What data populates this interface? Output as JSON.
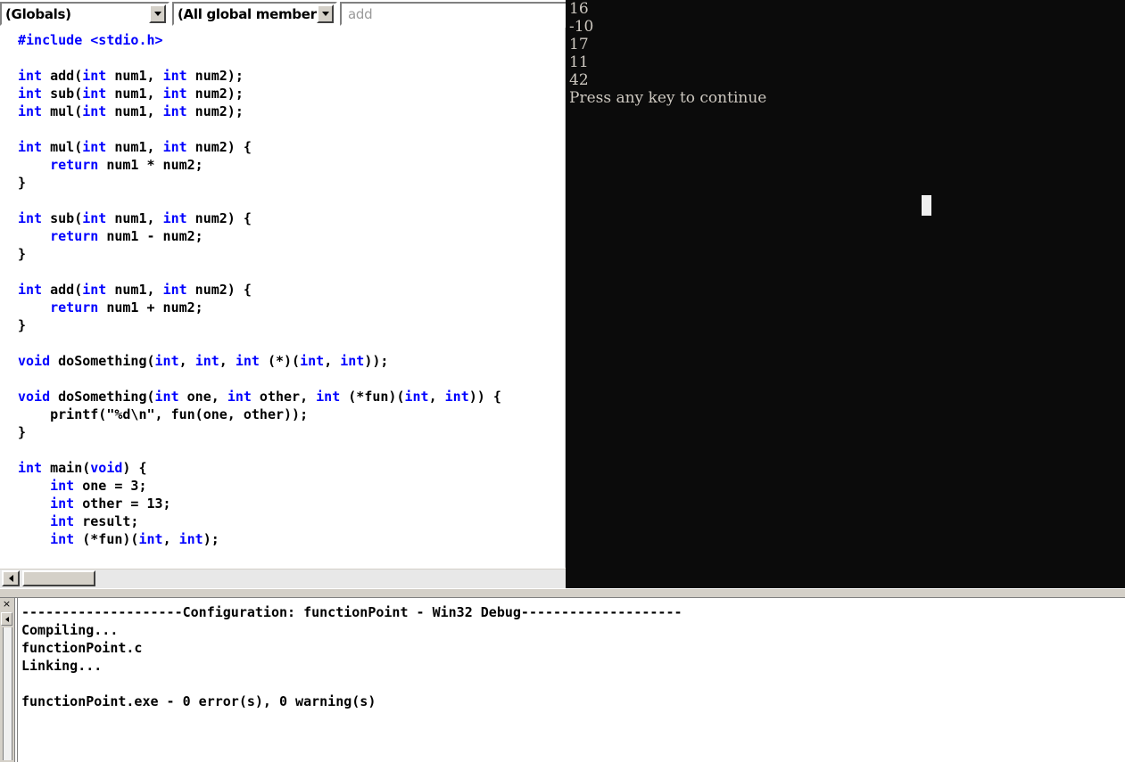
{
  "toolbar": {
    "scope_combo": {
      "value": "(Globals)",
      "dropdown_icon": "chevron-down-icon"
    },
    "members_combo": {
      "value": "(All global members",
      "dropdown_icon": "chevron-down-icon"
    },
    "find_field": {
      "value": "add",
      "placeholder": "add"
    }
  },
  "editor": {
    "language": "c",
    "keyword_color": "#0000ff",
    "text_color": "#000000",
    "background": "#ffffff",
    "lines": [
      [
        {
          "t": "#include <stdio.h>",
          "c": "kw"
        }
      ],
      [],
      [
        {
          "t": "int",
          "c": "kw"
        },
        {
          "t": " add("
        },
        {
          "t": "int",
          "c": "kw"
        },
        {
          "t": " num1, "
        },
        {
          "t": "int",
          "c": "kw"
        },
        {
          "t": " num2);"
        }
      ],
      [
        {
          "t": "int",
          "c": "kw"
        },
        {
          "t": " sub("
        },
        {
          "t": "int",
          "c": "kw"
        },
        {
          "t": " num1, "
        },
        {
          "t": "int",
          "c": "kw"
        },
        {
          "t": " num2);"
        }
      ],
      [
        {
          "t": "int",
          "c": "kw"
        },
        {
          "t": " mul("
        },
        {
          "t": "int",
          "c": "kw"
        },
        {
          "t": " num1, "
        },
        {
          "t": "int",
          "c": "kw"
        },
        {
          "t": " num2);"
        }
      ],
      [],
      [
        {
          "t": "int",
          "c": "kw"
        },
        {
          "t": " mul("
        },
        {
          "t": "int",
          "c": "kw"
        },
        {
          "t": " num1, "
        },
        {
          "t": "int",
          "c": "kw"
        },
        {
          "t": " num2) {"
        }
      ],
      [
        {
          "t": "    "
        },
        {
          "t": "return",
          "c": "kw"
        },
        {
          "t": " num1 * num2;"
        }
      ],
      [
        {
          "t": "}"
        }
      ],
      [],
      [
        {
          "t": "int",
          "c": "kw"
        },
        {
          "t": " sub("
        },
        {
          "t": "int",
          "c": "kw"
        },
        {
          "t": " num1, "
        },
        {
          "t": "int",
          "c": "kw"
        },
        {
          "t": " num2) {"
        }
      ],
      [
        {
          "t": "    "
        },
        {
          "t": "return",
          "c": "kw"
        },
        {
          "t": " num1 - num2;"
        }
      ],
      [
        {
          "t": "}"
        }
      ],
      [],
      [
        {
          "t": "int",
          "c": "kw"
        },
        {
          "t": " add("
        },
        {
          "t": "int",
          "c": "kw"
        },
        {
          "t": " num1, "
        },
        {
          "t": "int",
          "c": "kw"
        },
        {
          "t": " num2) {"
        }
      ],
      [
        {
          "t": "    "
        },
        {
          "t": "return",
          "c": "kw"
        },
        {
          "t": " num1 + num2;"
        }
      ],
      [
        {
          "t": "}"
        }
      ],
      [],
      [
        {
          "t": "void",
          "c": "kw"
        },
        {
          "t": " doSomething("
        },
        {
          "t": "int",
          "c": "kw"
        },
        {
          "t": ", "
        },
        {
          "t": "int",
          "c": "kw"
        },
        {
          "t": ", "
        },
        {
          "t": "int",
          "c": "kw"
        },
        {
          "t": " (*)("
        },
        {
          "t": "int",
          "c": "kw"
        },
        {
          "t": ", "
        },
        {
          "t": "int",
          "c": "kw"
        },
        {
          "t": "));"
        }
      ],
      [],
      [
        {
          "t": "void",
          "c": "kw"
        },
        {
          "t": " doSomething("
        },
        {
          "t": "int",
          "c": "kw"
        },
        {
          "t": " one, "
        },
        {
          "t": "int",
          "c": "kw"
        },
        {
          "t": " other, "
        },
        {
          "t": "int",
          "c": "kw"
        },
        {
          "t": " (*fun)("
        },
        {
          "t": "int",
          "c": "kw"
        },
        {
          "t": ", "
        },
        {
          "t": "int",
          "c": "kw"
        },
        {
          "t": ")) {"
        }
      ],
      [
        {
          "t": "    printf(\"%d\\n\", fun(one, other));"
        }
      ],
      [
        {
          "t": "}"
        }
      ],
      [],
      [
        {
          "t": "int",
          "c": "kw"
        },
        {
          "t": " main("
        },
        {
          "t": "void",
          "c": "kw"
        },
        {
          "t": ") {"
        }
      ],
      [
        {
          "t": "    "
        },
        {
          "t": "int",
          "c": "kw"
        },
        {
          "t": " one = 3;"
        }
      ],
      [
        {
          "t": "    "
        },
        {
          "t": "int",
          "c": "kw"
        },
        {
          "t": " other = 13;"
        }
      ],
      [
        {
          "t": "    "
        },
        {
          "t": "int",
          "c": "kw"
        },
        {
          "t": " result;"
        }
      ],
      [
        {
          "t": "    "
        },
        {
          "t": "int",
          "c": "kw"
        },
        {
          "t": " (*fun)("
        },
        {
          "t": "int",
          "c": "kw"
        },
        {
          "t": ", "
        },
        {
          "t": "int",
          "c": "kw"
        },
        {
          "t": ");"
        }
      ]
    ]
  },
  "console": {
    "background": "#0b0b0b",
    "text_color": "#cdc8c0",
    "output_lines": [
      "16",
      "-10",
      "17",
      "11",
      "42",
      "Press any key to continue"
    ],
    "cursor_visible": true
  },
  "build_output": {
    "close_icon": "close-icon",
    "scroll_icon": "scroll-left-icon",
    "lines": [
      "--------------------Configuration: functionPoint - Win32 Debug--------------------",
      "Compiling...",
      "functionPoint.c",
      "Linking...",
      "",
      "functionPoint.exe - 0 error(s), 0 warning(s)"
    ]
  }
}
